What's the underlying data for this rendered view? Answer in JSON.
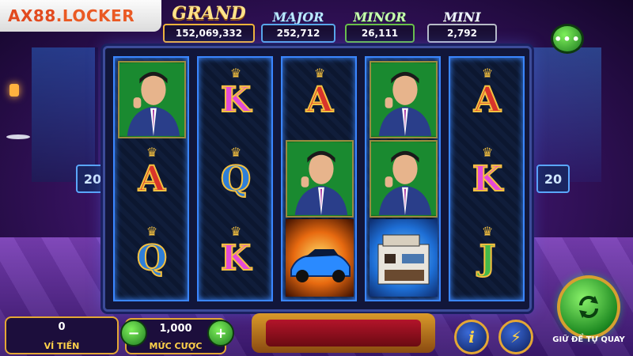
{
  "brand": {
    "part1": "AX88",
    "part2": ".LOCKER"
  },
  "jackpots": {
    "grand": {
      "name": "GRAND",
      "value": "152,069,332"
    },
    "major": {
      "name": "MAJOR",
      "value": "252,712"
    },
    "minor": {
      "name": "MINOR",
      "value": "26,111"
    },
    "mini": {
      "name": "MINI",
      "value": "2,792"
    }
  },
  "menu": {
    "label": "•••"
  },
  "paylines": {
    "left": "20",
    "right": "20"
  },
  "reels": [
    [
      "man",
      "A",
      "Q"
    ],
    [
      "K",
      "Q",
      "K"
    ],
    [
      "A",
      "man",
      "car"
    ],
    [
      "man",
      "man",
      "house"
    ],
    [
      "A",
      "K",
      "J"
    ]
  ],
  "wallet": {
    "value": "0",
    "label": "VÍ TIỀN"
  },
  "bet": {
    "value": "1,000",
    "label": "MỨC CƯỢC",
    "minus": "−",
    "plus": "+"
  },
  "buttons": {
    "info": "i",
    "turbo": "⚡",
    "spin_hint": "GIỮ ĐỂ TỰ QUAY"
  },
  "colors": {
    "accent_gold": "#e4a735",
    "reel_border": "#3a86ff",
    "spin_green": "#1e8a22"
  }
}
